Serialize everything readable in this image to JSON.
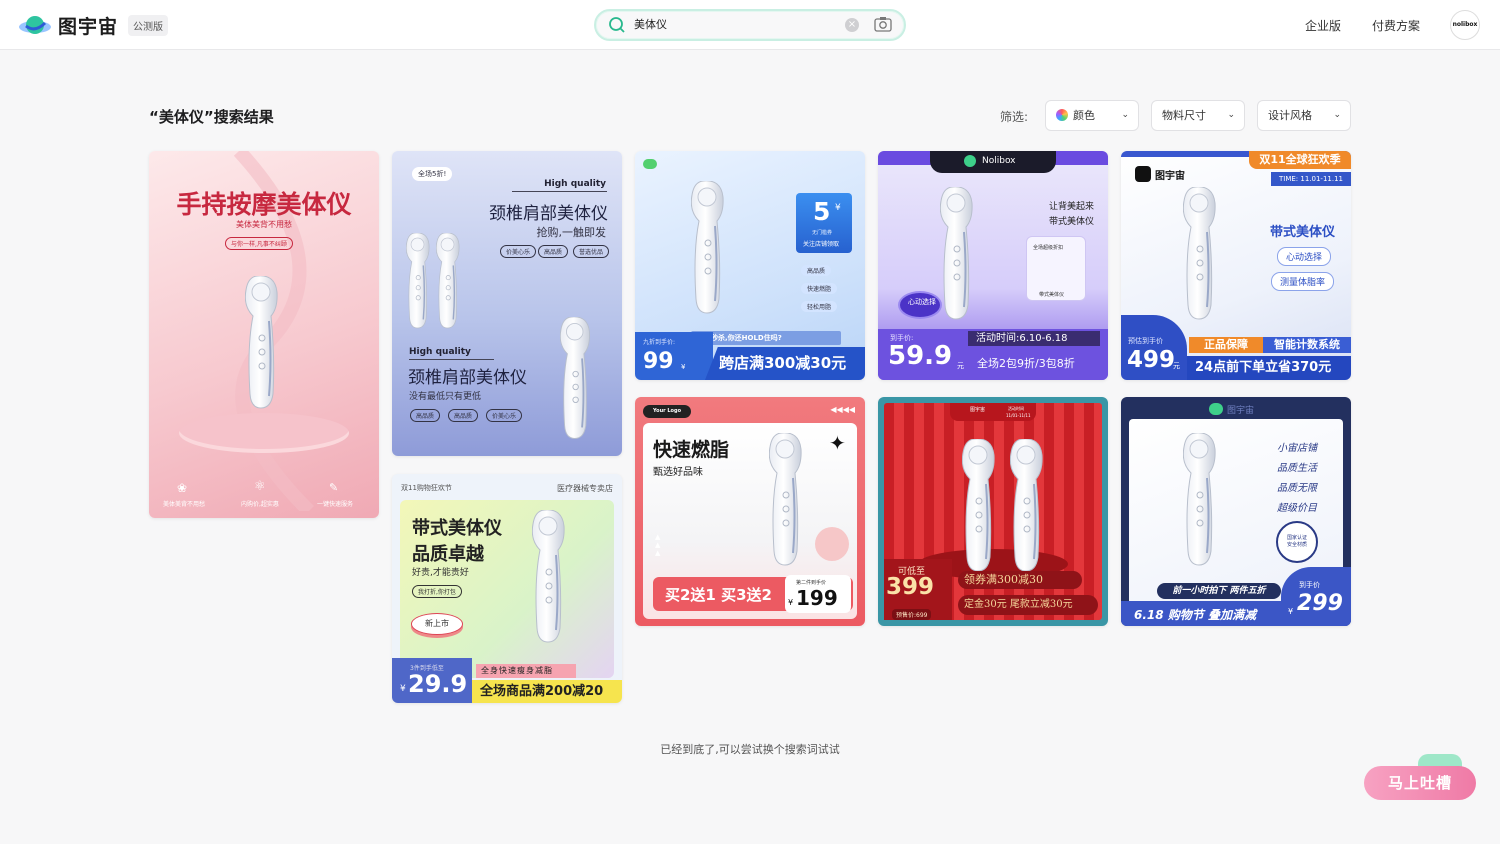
{
  "header": {
    "brand": "图宇宙",
    "beta_badge": "公测版",
    "search": {
      "value": "美体仪",
      "clear_icon": "close-circle-icon",
      "camera_icon": "camera-icon"
    },
    "nav": [
      "企业版",
      "付费方案"
    ],
    "avatar_text": "nolibox"
  },
  "results": {
    "title": "“美体仪”搜索结果",
    "filter_label": "筛选:",
    "filters": [
      "颜色",
      "物料尺寸",
      "设计风格"
    ]
  },
  "cards": {
    "c1": {
      "title": "手持按摩美体仪",
      "sub": "美体美背不用愁",
      "pill": "与你一样,凡事不纠颐",
      "f1": "美体美背不用愁",
      "f2": "内购价,超实惠",
      "f3": "一键快速服务"
    },
    "c2": {
      "badge": "全场5折!",
      "hq1": "High quality",
      "t1": "颈椎肩部美体仪",
      "s1": "抢购,一触即发",
      "tags1": [
        "价美心乐",
        "高品质",
        "誉选优品"
      ],
      "hq2": "High quality",
      "t2": "颈椎肩部美体仪",
      "s2": "没有最低只有更低",
      "tags2": [
        "高品质",
        "高品质",
        "价美心乐"
      ]
    },
    "c3": {
      "store": "双11购物狂欢节",
      "cat": "医疗器械专卖店",
      "t1": "带式美体仪",
      "t2": "品质卓越",
      "sub": "好贵,才能贵好",
      "pill": "我打折,你打包",
      "new": "新上市",
      "price_label": "3件到手低至",
      "price": "29.9",
      "yen": "¥",
      "promo1": "全身快速瘦身减脂",
      "promo2": "全场商品满200减20"
    },
    "c4": {
      "coupon_big": "5",
      "coupon_small": "¥",
      "coupon_txt1": "无门槛券",
      "coupon_txt2": "关注店铺领取",
      "tags": [
        "高品质",
        "快速燃脂",
        "轻松用脂"
      ],
      "banner": "全场秒杀,你还HOLD住吗?",
      "price_label": "九折到手价:",
      "price": "99",
      "unit": "¥",
      "promo": "跨店满300减30元"
    },
    "c5": {
      "logo": "Your Logo",
      "arrows": "◀◀◀◀",
      "t1": "快速燃脂",
      "t2": "甄选好品味",
      "promo": "买2送1 买3送2",
      "price_label": "第二件到手价",
      "price": "199",
      "yen": "¥"
    },
    "c6": {
      "brand": "Nolibox",
      "t1": "让背美起来",
      "t2": "带式美体仪",
      "badge": "心动选择",
      "box1": "全场超级折扣",
      "box2": "带式美体仪",
      "price_label": "到手价:",
      "price": "59.9",
      "unit": "元",
      "time": "活动时间:6.10-6.18",
      "promo": "全场2包9折/3包8折"
    },
    "c7": {
      "logo": "图宇宙",
      "time_label": "活动时间",
      "time_value": "11/01-11/11",
      "price_label": "可低至",
      "price": "399",
      "orig": "预售价:699",
      "promo1": "领券满300减30",
      "promo2": "定金30元 尾款立减30元"
    },
    "c8": {
      "brand": "图宇宙",
      "event": "双11全球狂欢季",
      "time": "TIME: 11.01-11.11",
      "title": "带式美体仪",
      "pill1": "心动选择",
      "pill2": "测量体脂率",
      "price_label": "预估到手价",
      "price": "499",
      "unit": "元",
      "tag1": "正品保障",
      "tag2": "智能计数系统",
      "promo": "24点前下单立省370元"
    },
    "c9": {
      "brand": "图宇宙",
      "lines": [
        "小宙店铺",
        "品质生活",
        "品质无限",
        "超级价目"
      ],
      "seal": "国家认证 安全材质",
      "banner": "前一小时拍下 两件五折",
      "promo": "6.18 购物节  叠加满减",
      "price_label": "到手价",
      "price": "299",
      "yen": "¥"
    }
  },
  "footer": {
    "note": "已经到底了,可以尝试换个搜索词试试",
    "feedback": "马上吐槽"
  },
  "colors": {
    "accent": "#27c59a",
    "brand_blue": "#3b5bdb"
  }
}
